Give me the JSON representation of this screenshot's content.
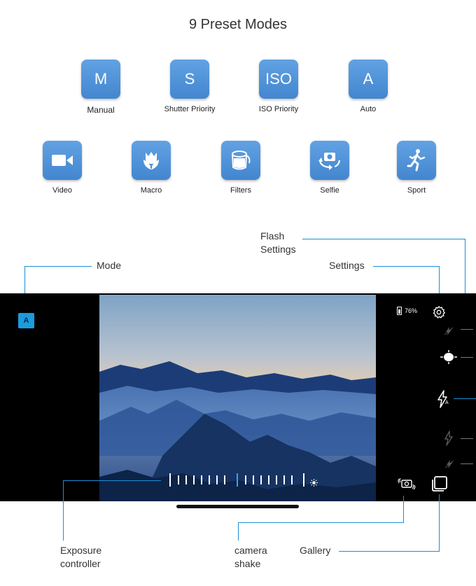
{
  "title": "9 Preset Modes",
  "modes_row1": [
    {
      "glyph": "M",
      "label": "Manual"
    },
    {
      "glyph": "S",
      "label": "Shutter Priority"
    },
    {
      "glyph": "ISO",
      "label": "ISO Priority"
    },
    {
      "glyph": "A",
      "label": "Auto"
    }
  ],
  "modes_row2": [
    {
      "icon": "video-camera-icon",
      "label": "Video"
    },
    {
      "icon": "tulip-icon",
      "label": "Macro"
    },
    {
      "icon": "paint-bucket-icon",
      "label": "Filters"
    },
    {
      "icon": "rotate-camera-icon",
      "label": "Selfie"
    },
    {
      "icon": "runner-icon",
      "label": "Sport"
    }
  ],
  "callouts": {
    "mode": "Mode",
    "flash": "Flash Settings",
    "settings": "Settings",
    "exposure": "Exposure controller",
    "shake": "camera shake",
    "gallery": "Gallery"
  },
  "camera": {
    "mode_badge": "A",
    "battery": "76%"
  },
  "colors": {
    "accent": "#1b8fd6",
    "tile": "#4e93d8",
    "exposure_active": "#3aa2e8"
  }
}
